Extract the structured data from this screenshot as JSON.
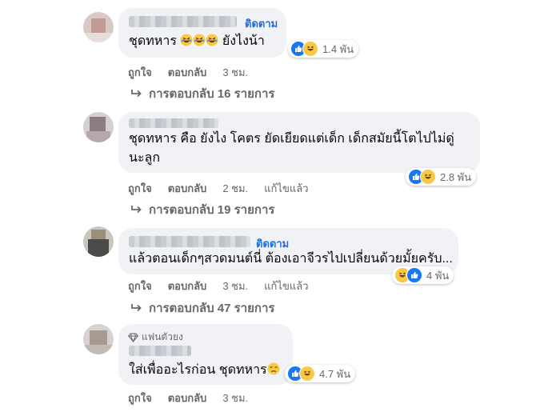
{
  "comments": [
    {
      "follow": "ติดตาม",
      "text": "ชุดทหาร 😂😂😂 ยังไงน้า",
      "text_before": "ชุดทหาร",
      "text_after": "ยังไงน้า",
      "reactions": {
        "count": "1.4 พัน",
        "icons": [
          "like-icon",
          "haha-icon"
        ]
      },
      "actions": {
        "like": "ถูกใจ",
        "reply": "ตอบกลับ",
        "time": "3 ชม."
      },
      "replies": "การตอบกลับ 16 รายการ"
    },
    {
      "text_line1": "ชุดทหาร คือ ยังไง โคตร ยัดเยียดแต่เด็ก เด็กสมัยนี้โตไปไม่ดู่",
      "text_line2": "นะลูก",
      "reactions": {
        "count": "2.8 พัน",
        "icons": [
          "like-icon",
          "haha-icon"
        ]
      },
      "actions": {
        "like": "ถูกใจ",
        "reply": "ตอบกลับ",
        "time": "2 ชม.",
        "edited": "แก้ไขแล้ว"
      },
      "replies": "การตอบกลับ 19 รายการ"
    },
    {
      "follow": "ติดตาม",
      "text": "แล้วตอนเด็กๆสวดมนต์นี่ ต้องเอาจีวรไปเปลี่ยนด้วยมั้ยครับ...",
      "reactions": {
        "count": "4 พัน",
        "icons": [
          "haha-icon",
          "like-icon"
        ]
      },
      "actions": {
        "like": "ถูกใจ",
        "reply": "ตอบกลับ",
        "time": "3 ชม.",
        "edited": "แก้ไขแล้ว"
      },
      "replies": "การตอบกลับ 47 รายการ"
    },
    {
      "badge": "แฟนตัวยง",
      "text": "ใส่เพื่ออะไรก่อน ชุดทหาร",
      "reactions": {
        "count": "4.7 พัน",
        "icons": [
          "like-icon",
          "haha-icon"
        ]
      },
      "actions": {
        "like": "ถูกใจ",
        "reply": "ตอบกลับ",
        "time": "3 ชม."
      }
    }
  ],
  "colors": {
    "bubble": "#f0f2f5",
    "link": "#216fdb",
    "meta": "#65676b",
    "like": "#1877f2",
    "haha": "#f7c945"
  }
}
